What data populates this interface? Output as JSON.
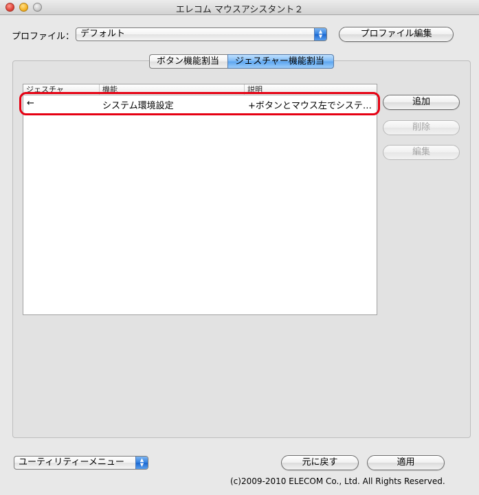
{
  "window": {
    "title": "エレコム マウスアシスタント２"
  },
  "profile": {
    "label": "プロファイル：",
    "selected": "デフォルト",
    "edit_button": "プロファイル編集"
  },
  "tabs": [
    {
      "label": "ボタン機能割当",
      "selected": false
    },
    {
      "label": "ジェスチャー機能割当",
      "selected": true
    }
  ],
  "table": {
    "columns": [
      "ジェスチャ",
      "機能",
      "説明"
    ],
    "rows": [
      {
        "gesture": "←",
        "function": "システム環境設定",
        "description": "+ボタンとマウス左でシステ…"
      }
    ]
  },
  "side_buttons": {
    "add": "追加",
    "delete": "削除",
    "edit": "編集"
  },
  "footer": {
    "utility_menu": "ユーティリティーメニュー",
    "revert_button": "元に戻す",
    "apply_button": "適用",
    "copyright": "(c)2009-2010 ELECOM Co., Ltd. All Rights Reserved."
  },
  "colors": {
    "highlight": "#e60012",
    "selected_tab": "#7ab8f5"
  }
}
